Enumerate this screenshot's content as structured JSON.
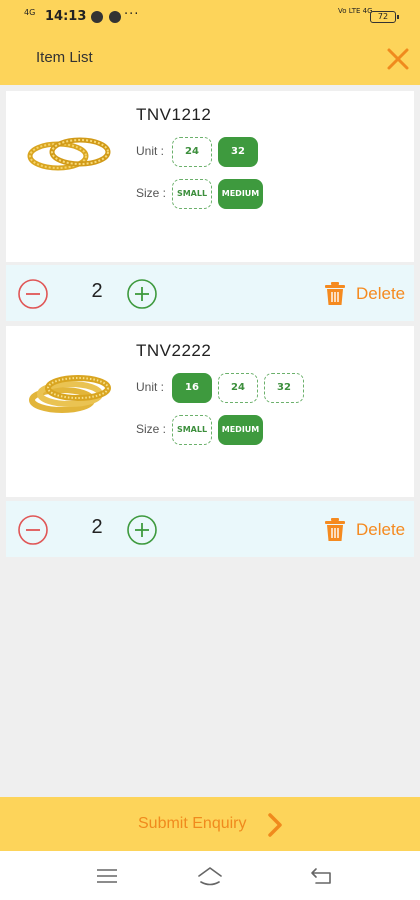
{
  "status_bar": {
    "network": "4G",
    "time": "14:13",
    "more": "···",
    "signal": "Vo LTE 4G",
    "battery": "72"
  },
  "header": {
    "title": "Item List",
    "close_icon": "close-icon"
  },
  "items": [
    {
      "code": "TNV1212",
      "unit_label": "Unit :",
      "size_label": "Size :",
      "units": [
        {
          "label": "24",
          "selected": false
        },
        {
          "label": "32",
          "selected": true
        }
      ],
      "sizes": [
        {
          "label": "SMALL",
          "selected": false
        },
        {
          "label": "MEDIUM",
          "selected": true
        }
      ],
      "quantity": "2",
      "delete_label": "Delete"
    },
    {
      "code": "TNV2222",
      "unit_label": "Unit :",
      "size_label": "Size :",
      "units": [
        {
          "label": "16",
          "selected": true
        },
        {
          "label": "24",
          "selected": false
        },
        {
          "label": "32",
          "selected": false
        }
      ],
      "sizes": [
        {
          "label": "SMALL",
          "selected": false
        },
        {
          "label": "MEDIUM",
          "selected": true
        }
      ],
      "quantity": "2",
      "delete_label": "Delete"
    }
  ],
  "footer": {
    "submit_label": "Submit Enquiry"
  },
  "colors": {
    "header_bg": "#fdd45a",
    "accent_orange": "#f58a1f",
    "chip_green": "#3e9a3e",
    "minus_red": "#e05656",
    "plus_green": "#3e9a3e",
    "qty_bar_bg": "#eaf8fb"
  },
  "icons": [
    "minus-circle-icon",
    "plus-circle-icon",
    "trash-icon",
    "chevron-right-icon",
    "menu-icon",
    "home-icon",
    "back-icon"
  ]
}
